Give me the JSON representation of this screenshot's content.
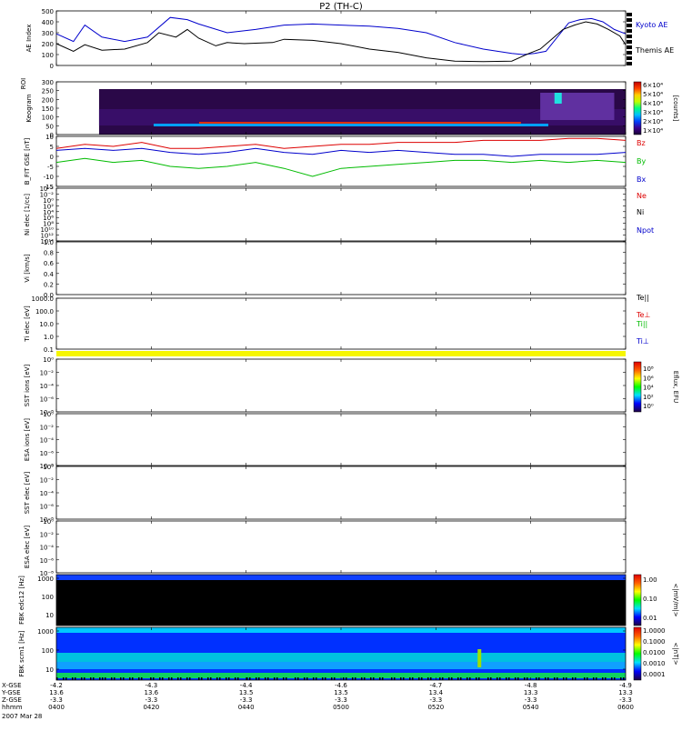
{
  "title": "P2 (TH-C)",
  "colors": {
    "kyoto": "#0000cc",
    "themis": "#000000",
    "bz": "#dd0000",
    "by": "#00bb00",
    "bx": "#0000cc",
    "ne": "#dd0000",
    "ni": "#000000",
    "npot": "#0000cc",
    "te_par": "#000000",
    "te_perp": "#dd0000",
    "ti_par": "#00bb00",
    "ti_perp": "#0000cc",
    "mode_bar": "#f6f600",
    "tick_black": "#000000"
  },
  "chart_data": [
    {
      "id": "ae",
      "type": "line",
      "ylabel": "AE Index",
      "y_ticks": [
        "500",
        "400",
        "300",
        "200",
        "100",
        "0"
      ],
      "ylim": [
        0,
        500
      ],
      "legend": [
        "Kyoto AE",
        "Themis AE"
      ],
      "series": [
        {
          "name": "Kyoto AE",
          "color_key": "kyoto",
          "x": [
            0,
            0.03,
            0.05,
            0.08,
            0.12,
            0.16,
            0.2,
            0.23,
            0.25,
            0.3,
            0.35,
            0.4,
            0.45,
            0.5,
            0.55,
            0.6,
            0.65,
            0.7,
            0.75,
            0.8,
            0.82,
            0.84,
            0.86,
            0.88,
            0.9,
            0.92,
            0.94,
            0.96,
            0.98,
            1
          ],
          "y": [
            290,
            220,
            370,
            260,
            220,
            260,
            440,
            420,
            380,
            300,
            330,
            370,
            380,
            370,
            360,
            340,
            300,
            210,
            150,
            110,
            100,
            110,
            130,
            260,
            390,
            420,
            430,
            400,
            330,
            290
          ]
        },
        {
          "name": "Themis AE",
          "color_key": "themis",
          "x": [
            0,
            0.03,
            0.05,
            0.08,
            0.12,
            0.16,
            0.18,
            0.21,
            0.23,
            0.25,
            0.28,
            0.3,
            0.33,
            0.38,
            0.4,
            0.45,
            0.5,
            0.55,
            0.6,
            0.65,
            0.7,
            0.75,
            0.8,
            0.83,
            0.85,
            0.87,
            0.89,
            0.91,
            0.93,
            0.95,
            0.97,
            0.99,
            1
          ],
          "y": [
            200,
            130,
            190,
            140,
            150,
            210,
            300,
            260,
            330,
            250,
            180,
            210,
            200,
            210,
            240,
            230,
            200,
            150,
            120,
            70,
            40,
            35,
            40,
            110,
            150,
            240,
            330,
            370,
            400,
            380,
            330,
            270,
            190
          ]
        }
      ]
    },
    {
      "id": "keogram",
      "type": "heatmap",
      "ylabel": "Keogram",
      "ylabel2": "ROI",
      "y_ticks": [
        "300",
        "250",
        "200",
        "150",
        "100",
        "50",
        "0"
      ],
      "ylim": [
        0,
        300
      ],
      "colorbar_ticks": [
        "6×10⁴",
        "5×10⁴",
        "4×10⁴",
        "3×10⁴",
        "2×10⁴",
        "1×10⁴"
      ],
      "colorbar_unit": "[counts]",
      "data_start": 0.075,
      "features": [
        {
          "x_start": 0.075,
          "x_end": 0.96,
          "y": 60,
          "intensity": "high",
          "label": "band"
        },
        {
          "x_start": 0.85,
          "x_end": 0.98,
          "y": 230,
          "intensity": "high",
          "label": "arc"
        }
      ]
    },
    {
      "id": "bfield",
      "type": "line",
      "ylabel": "B_FIT GSE [nT]",
      "y_ticks": [
        "10",
        "5",
        "0",
        "-5",
        "-10",
        "-15"
      ],
      "ylim": [
        -15,
        10
      ],
      "legend": [
        "Bz",
        "By",
        "Bx"
      ],
      "series": [
        {
          "name": "Bz",
          "color_key": "bz",
          "x": [
            0,
            0.05,
            0.1,
            0.15,
            0.2,
            0.25,
            0.3,
            0.35,
            0.4,
            0.45,
            0.5,
            0.55,
            0.6,
            0.65,
            0.7,
            0.75,
            0.8,
            0.85,
            0.9,
            0.95,
            1
          ],
          "y": [
            4,
            6,
            5,
            7,
            4,
            4,
            5,
            6,
            4,
            5,
            6,
            6,
            7,
            7,
            7,
            8,
            8,
            8,
            9,
            9,
            8
          ]
        },
        {
          "name": "By",
          "color_key": "by",
          "x": [
            0,
            0.05,
            0.1,
            0.15,
            0.2,
            0.25,
            0.3,
            0.35,
            0.4,
            0.45,
            0.5,
            0.55,
            0.6,
            0.65,
            0.7,
            0.75,
            0.8,
            0.85,
            0.9,
            0.95,
            1
          ],
          "y": [
            -3,
            -1,
            -3,
            -2,
            -5,
            -6,
            -5,
            -3,
            -6,
            -10,
            -6,
            -5,
            -4,
            -3,
            -2,
            -2,
            -3,
            -2,
            -3,
            -2,
            -3
          ]
        },
        {
          "name": "Bx",
          "color_key": "bx",
          "x": [
            0,
            0.05,
            0.1,
            0.15,
            0.2,
            0.25,
            0.3,
            0.35,
            0.4,
            0.45,
            0.5,
            0.55,
            0.6,
            0.65,
            0.7,
            0.75,
            0.8,
            0.85,
            0.9,
            0.95,
            1
          ],
          "y": [
            3,
            4,
            3,
            4,
            2,
            1,
            2,
            4,
            2,
            1,
            3,
            2,
            3,
            2,
            1,
            1,
            0,
            1,
            1,
            1,
            2
          ]
        }
      ]
    },
    {
      "id": "density",
      "type": "line",
      "ylabel": "Ni elec [1/cc]",
      "y_ticks": [
        "10⁻²",
        "10⁻²",
        "10⁰",
        "10²",
        "10⁴",
        "10⁶",
        "10⁸",
        "10¹⁰",
        "10¹²",
        "10¹⁴"
      ],
      "legend": [
        "Ne",
        "Ni",
        "Npot"
      ],
      "series": []
    },
    {
      "id": "velocity",
      "type": "line",
      "ylabel": "Vi [km/s]",
      "y_ticks": [
        "1.0",
        "0.8",
        "0.6",
        "0.4",
        "0.2",
        "0.0"
      ],
      "ylim": [
        0,
        1
      ],
      "series": []
    },
    {
      "id": "temperature",
      "type": "line",
      "ylabel": "Ti elec [eV]",
      "y_ticks": [
        "1000.0",
        "100.0",
        "10.0",
        "1.0",
        "0.1"
      ],
      "legend": [
        "Te||",
        "Te⊥",
        "Ti||",
        "Ti⊥"
      ],
      "series": []
    },
    {
      "id": "sst_ion",
      "type": "heatmap",
      "ylabel": "SST ions [eV]",
      "y_ticks": [
        "10⁰",
        "10⁻²",
        "10⁻⁴",
        "10⁻⁶",
        "10⁻⁸"
      ],
      "colorbar_ticks": [
        "10⁸",
        "10⁶",
        "10⁴",
        "10²",
        "10⁰"
      ],
      "colorbar_unit": "Eflux, EFU"
    },
    {
      "id": "esa_ion",
      "type": "heatmap",
      "ylabel": "ESA ions [eV]",
      "y_ticks": [
        "10⁰",
        "10⁻²",
        "10⁻⁴",
        "10⁻⁶",
        "10⁻⁸"
      ]
    },
    {
      "id": "sst_elec",
      "type": "heatmap",
      "ylabel": "SST elec [eV]",
      "y_ticks": [
        "10⁰",
        "10⁻²",
        "10⁻⁴",
        "10⁻⁶",
        "10⁻⁸"
      ]
    },
    {
      "id": "esa_elec",
      "type": "heatmap",
      "ylabel": "ESA elec [eV]",
      "y_ticks": [
        "10⁰",
        "10⁻²",
        "10⁻⁴",
        "10⁻⁶",
        "10⁻⁸"
      ]
    },
    {
      "id": "fbk_edc",
      "type": "heatmap",
      "ylabel": "FBK edc12 [Hz]",
      "y_ticks": [
        "1000",
        "100",
        "10"
      ],
      "colorbar_ticks": [
        "1.00",
        "0.10",
        "0.01"
      ],
      "colorbar_unit": "<|mV/m|>"
    },
    {
      "id": "fbk_scm",
      "type": "heatmap",
      "ylabel": "FBK scm1 [Hz]",
      "y_ticks": [
        "1000",
        "100",
        "10"
      ],
      "colorbar_ticks": [
        "1.0000",
        "0.1000",
        "0.0100",
        "0.0010",
        "0.0001"
      ],
      "colorbar_unit": "<|nT|>"
    }
  ],
  "x_axis": {
    "row_labels": [
      "X-GSE",
      "Y-GSE",
      "Z-GSE",
      "hhmm",
      "2007 Mar 28"
    ],
    "ticks": [
      {
        "x": 0.0,
        "vals": [
          "-4.2",
          "13.6",
          "-3.3",
          "0400"
        ]
      },
      {
        "x": 0.1667,
        "vals": [
          "-4.3",
          "13.6",
          "-3.3",
          "0420"
        ]
      },
      {
        "x": 0.3333,
        "vals": [
          "-4.4",
          "13.5",
          "-3.3",
          "0440"
        ]
      },
      {
        "x": 0.5,
        "vals": [
          "-4.6",
          "13.5",
          "-3.3",
          "0500"
        ]
      },
      {
        "x": 0.6667,
        "vals": [
          "-4.7",
          "13.4",
          "-3.3",
          "0520"
        ]
      },
      {
        "x": 0.8333,
        "vals": [
          "-4.8",
          "13.3",
          "-3.3",
          "0540"
        ]
      },
      {
        "x": 1.0,
        "vals": [
          "-4.9",
          "13.3",
          "-3.3",
          "0600"
        ]
      }
    ]
  }
}
